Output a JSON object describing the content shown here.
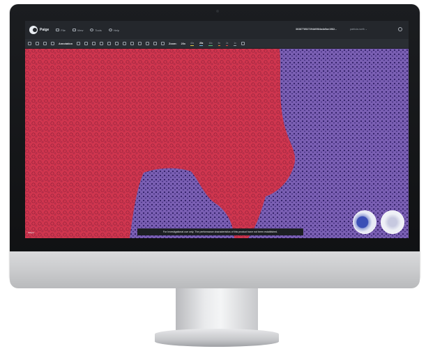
{
  "app": {
    "name": "Paige",
    "case_id": "3638778527294d0984a4a5ae1982...",
    "user": "patricia.north"
  },
  "menu": {
    "items": [
      {
        "label": "File",
        "icon": "folder-icon"
      },
      {
        "label": "View",
        "icon": "view-icon"
      },
      {
        "label": "Tools",
        "icon": "tools-icon"
      },
      {
        "label": "Help",
        "icon": "help-icon"
      }
    ]
  },
  "toolbar": {
    "annotation_label": "Annotation",
    "zoom_label": "Zoom:",
    "zoom_value": "20x",
    "zoom_presets": [
      {
        "label": "40x",
        "color": "#e2c94a"
      },
      {
        "label": "20x",
        "color": "#6fb3e0"
      },
      {
        "label": "10x",
        "color": "#57c07a"
      },
      {
        "label": "5x",
        "color": "#e08a3c"
      },
      {
        "label": "2x",
        "color": "#d34b4b"
      },
      {
        "label": "1x",
        "color": "#9aa2aa"
      }
    ]
  },
  "viewer": {
    "disclaimer": "For Investigational use only. The performance characteristics of this product have not been established.",
    "scale_label": "200µm",
    "overlay_color": "#d4344a",
    "tissue_color": "#6d53a8"
  }
}
